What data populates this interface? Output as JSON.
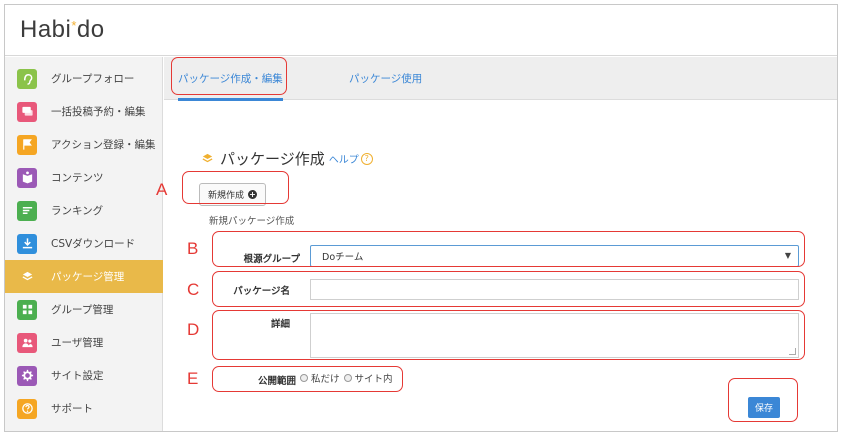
{
  "app": {
    "logo_text": "Habi",
    "logo_star": "*",
    "logo_suffix": "do"
  },
  "sidebar": {
    "items": [
      {
        "label": "グループフォロー",
        "icon": "ear-icon",
        "color": "#8bc34a",
        "active": false
      },
      {
        "label": "一括投稿予約・編集",
        "icon": "chat-bubbles-icon",
        "color": "#e8587a",
        "active": false
      },
      {
        "label": "アクション登録・編集",
        "icon": "flag-icon",
        "color": "#f5a623",
        "active": false
      },
      {
        "label": "コンテンツ",
        "icon": "book-icon",
        "color": "#9b59b6",
        "active": false
      },
      {
        "label": "ランキング",
        "icon": "list-icon",
        "color": "#4caf50",
        "active": false
      },
      {
        "label": "CSVダウンロード",
        "icon": "download-icon",
        "color": "#2f8fdc",
        "active": false
      },
      {
        "label": "パッケージ管理",
        "icon": "layers-icon",
        "color": "#e9b949",
        "active": true
      },
      {
        "label": "グループ管理",
        "icon": "grid-icon",
        "color": "#4caf50",
        "active": false
      },
      {
        "label": "ユーザ管理",
        "icon": "users-icon",
        "color": "#e8587a",
        "active": false
      },
      {
        "label": "サイト設定",
        "icon": "gear-icon",
        "color": "#9b59b6",
        "active": false
      },
      {
        "label": "サポート",
        "icon": "question-icon",
        "color": "#f5a623",
        "active": false
      }
    ]
  },
  "tabs": [
    {
      "label": "パッケージ作成・編集",
      "active": true
    },
    {
      "label": "パッケージ使用",
      "active": false
    }
  ],
  "main": {
    "title": "パッケージ作成",
    "help_label": "ヘルプ",
    "help_icon": "?",
    "new_button": "新規作成",
    "new_button_icon": "+",
    "sub_caption": "新規パッケージ作成",
    "form": {
      "group_label": "根源グループ",
      "group_value": "Doチーム",
      "name_label": "パッケージ名",
      "name_value": "",
      "detail_label": "詳細",
      "detail_value": "",
      "scope_label": "公開範囲",
      "scope_options": [
        "私だけ",
        "サイト内"
      ]
    },
    "save_button": "保存"
  },
  "annotations": [
    "A",
    "B",
    "C",
    "D",
    "E"
  ],
  "colors": {
    "accent": "#3b87d6",
    "active_nav": "#e9b949",
    "annotation": "#e53935"
  }
}
